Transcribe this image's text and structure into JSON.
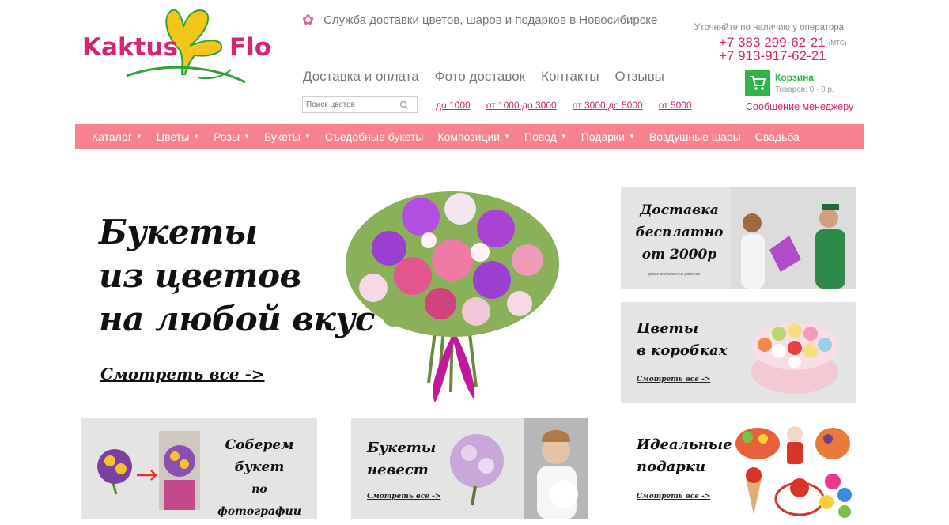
{
  "logo": {
    "word1": "Kaktus",
    "word2": "Flo"
  },
  "header": {
    "tagline": "Служба доставки цветов, шаров и подарков в Новосибирске",
    "operator_note": "Уточняйте по наличию у оператора",
    "phone1": "+7 383 299-62-21",
    "phone1_note": "(МТС)",
    "phone2": "+7 913-917-62-21"
  },
  "topnav": [
    "Доставка и оплата",
    "Фото доставок",
    "Контакты",
    "Отзывы"
  ],
  "search": {
    "placeholder": "Поиск цветов"
  },
  "price_filters": [
    "до 1000",
    "от 1000 до 3000",
    "от 3000 до 5000",
    "от 5000"
  ],
  "cart": {
    "title": "Корзина",
    "info": "Товаров: 0 - 0 р.",
    "manager_link": "Сообщение менеджеру"
  },
  "mainmenu": [
    {
      "label": "Каталог",
      "dropdown": true
    },
    {
      "label": "Цветы",
      "dropdown": true
    },
    {
      "label": "Розы",
      "dropdown": true
    },
    {
      "label": "Букеты",
      "dropdown": true
    },
    {
      "label": "Съедобные букеты",
      "dropdown": false
    },
    {
      "label": "Композиции",
      "dropdown": true
    },
    {
      "label": "Повод",
      "dropdown": true
    },
    {
      "label": "Подарки",
      "dropdown": true
    },
    {
      "label": "Воздушные шары",
      "dropdown": false
    },
    {
      "label": "Свадьба",
      "dropdown": false
    }
  ],
  "hero": {
    "line1": "Букеты",
    "line2": "из цветов",
    "line3": "на любой вкус",
    "link": "Смотреть все ->"
  },
  "banners": {
    "delivery": {
      "line1": "Доставка",
      "line2": "бесплатно",
      "line3": "от 2000р",
      "note": "кроме отдаленных районов"
    },
    "boxes": {
      "line1": "Цветы",
      "line2": "в коробках",
      "link": "Смотреть все ->"
    },
    "photo": {
      "line1": "Соберем",
      "line2": "букет",
      "line3": "по фотографии"
    },
    "bride": {
      "line1": "Букеты",
      "line2": "невест",
      "link": "Смотреть все ->"
    },
    "gifts": {
      "line1": "Идеальные",
      "line2": "подарки",
      "link": "Смотреть все ->"
    }
  },
  "colors": {
    "brand_pink": "#d6246e",
    "menu_bg": "#f5828e",
    "cart_green": "#2fb44a",
    "logo_yellow": "#f2c51c",
    "logo_green": "#2aa43a"
  }
}
